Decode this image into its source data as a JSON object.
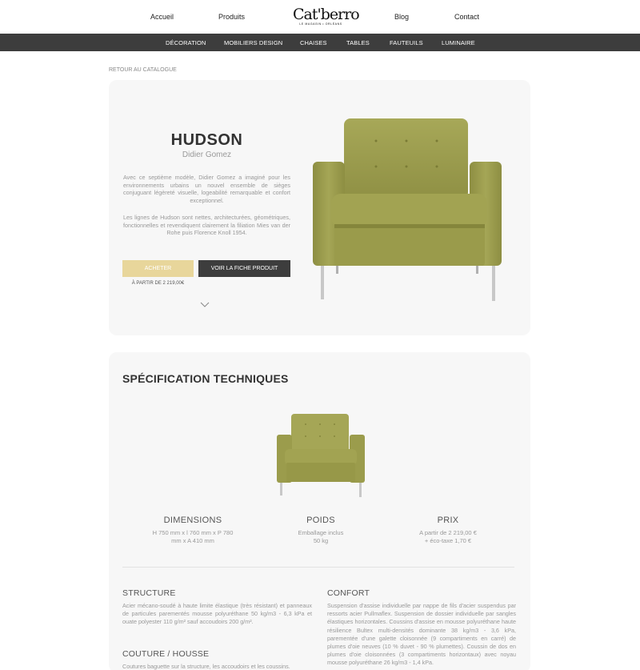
{
  "nav": {
    "home": "Accueil",
    "products": "Produits",
    "blog": "Blog",
    "contact": "Contact",
    "logo_text": "Cat'berro",
    "logo_sub": "LE MAGASIN • ORLÉANS"
  },
  "categories": [
    "DÉCORATION",
    "MOBILIERS DESIGN",
    "CHAISES",
    "TABLES",
    "FAUTEUILS",
    "LUMINAIRE"
  ],
  "back_link": "RETOUR AU CATALOGUE",
  "product": {
    "name": "HUDSON",
    "designer": "Didier Gomez",
    "desc1": "Avec ce septième modèle, Didier Gomez a imaginé pour les environnements urbains un nouvel ensemble de sièges conjuguant légèreté visuelle, logeabilité remarquable et confort exceptionnel.",
    "desc2": "Les lignes de Hudson sont nettes, architecturées, géométriques, fonctionnelles et revendiquent clairement la filiation Mies van der Rohe puis Florence Knoll 1954.",
    "buy_label": "ACHETER",
    "sheet_label": "VOIR LA FICHE PRODUIT",
    "price_from": "À PARTIR DE 2 219,00€",
    "image": "armchair-olive-green",
    "colors": {
      "accent": "#e8d69b",
      "dark": "#3d3d3d",
      "upholstery": "#9a9a4c"
    }
  },
  "specs": {
    "title": "SPÉCIFICATION TECHNIQUES",
    "dimensions": {
      "label": "DIMENSIONS",
      "line1": "H 750 mm x l 760 mm x P 780",
      "line2": "mm x A 410 mm"
    },
    "weight": {
      "label": "POIDS",
      "line1": "Emballage inclus",
      "line2": "50 kg"
    },
    "price": {
      "label": "PRIX",
      "line1": "A partir de 2 219,00 €",
      "line2": "+ éco-taxe 1,70 €"
    },
    "structure": {
      "label": "STRUCTURE",
      "text": "Acier mécano-soudé à haute limite élastique (très résistant) et panneaux de particules parementés mousse polyuréthane 50 kg/m3 - 6,3 kPa et ouate polyester 110 g/m² sauf accoudoirs 200 g/m²."
    },
    "cover": {
      "label": "COUTURE / HOUSSE",
      "text": "Coutures baguette sur la structure, les accoudoirs et les coussins."
    },
    "comfort": {
      "label": "CONFORT",
      "text": "Suspension d'assise individuelle par nappe de fils d'acier suspendus par ressorts acier Pullmaflex. Suspension de dossier individuelle par sangles élastiques horizontales. Coussins d'assise en mousse polyuréthane haute résilience Bultex multi-densités dominante 38 kg/m3 - 3,6 kPa, parementée d'une galette cloisonnée (9 compartiments en carré) de plumes d'oie neuves (10 % duvet - 90 % plumettes). Coussin de dos en plumes d'oie cloisonnées (3 compartiments horizontaux) avec noyau mousse polyuréthane 26 kg/m3 - 1,4 kPa."
    }
  }
}
